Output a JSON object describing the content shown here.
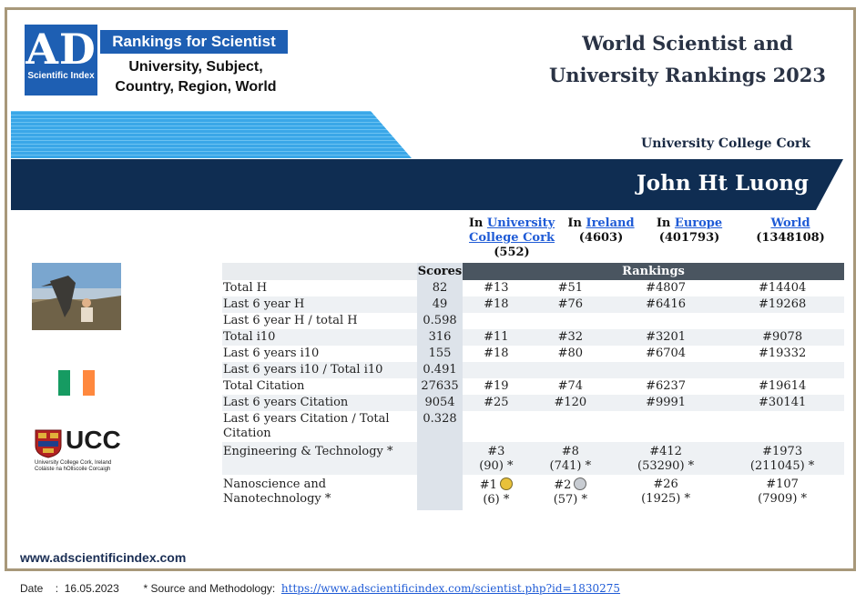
{
  "logo": {
    "mark": "AD",
    "sub": "Scientific Index",
    "title": "Rankings for Scientist",
    "desc": "University, Subject, Country, Region, World"
  },
  "header": {
    "title_line1": "World Scientist and",
    "title_line2": "University Rankings 2023"
  },
  "profile": {
    "university": "University College Cork",
    "name": "John Ht Luong"
  },
  "columns": [
    {
      "prefix": "In",
      "link": "University College Cork",
      "count": "(552)"
    },
    {
      "prefix": "In",
      "link": "Ireland",
      "count": "(4603)"
    },
    {
      "prefix": "In",
      "link": "Europe",
      "count": "(401793)"
    },
    {
      "prefix": "",
      "link": "World",
      "count": "(1348108)"
    }
  ],
  "table": {
    "scores_header": "Scores",
    "rankings_header": "Rankings",
    "rows": [
      {
        "label": "Total H",
        "score": "82",
        "r1": "#13",
        "r2": "#51",
        "r3": "#4807",
        "r4": "#14404"
      },
      {
        "label": "Last 6 year H",
        "score": "49",
        "r1": "#18",
        "r2": "#76",
        "r3": "#6416",
        "r4": "#19268"
      },
      {
        "label": "Last 6 year H / total H",
        "score": "0.598",
        "r1": "",
        "r2": "",
        "r3": "",
        "r4": ""
      },
      {
        "label": "Total i10",
        "score": "316",
        "r1": "#11",
        "r2": "#32",
        "r3": "#3201",
        "r4": "#9078"
      },
      {
        "label": "Last 6 years i10",
        "score": "155",
        "r1": "#18",
        "r2": "#80",
        "r3": "#6704",
        "r4": "#19332"
      },
      {
        "label": "Last 6 years i10 / Total i10",
        "score": "0.491",
        "r1": "",
        "r2": "",
        "r3": "",
        "r4": ""
      },
      {
        "label": "Total Citation",
        "score": "27635",
        "r1": "#19",
        "r2": "#74",
        "r3": "#6237",
        "r4": "#19614"
      },
      {
        "label": "Last 6 years Citation",
        "score": "9054",
        "r1": "#25",
        "r2": "#120",
        "r3": "#9991",
        "r4": "#30141"
      },
      {
        "label": "Last 6 years Citation / Total Citation",
        "score": "0.328",
        "r1": "",
        "r2": "",
        "r3": "",
        "r4": ""
      }
    ],
    "subjects": [
      {
        "label": "Engineering & Technology *",
        "r1": "#3",
        "r1b": "(90) *",
        "r2": "#8",
        "r2b": "(741) *",
        "r3": "#412",
        "r3b": "(53290) *",
        "r4": "#1973",
        "r4b": "(211045) *"
      },
      {
        "label": "Nanoscience and Nanotechnology *",
        "r1": "#1",
        "r1b": "(6) *",
        "r2": "#2",
        "r2b": "(57) *",
        "r3": "#26",
        "r3b": "(1925) *",
        "r4": "#107",
        "r4b": "(7909) *"
      }
    ]
  },
  "site": "www.adscientificindex.com",
  "footer": {
    "date_label": "Date",
    "date_sep": ":",
    "date": "16.05.2023",
    "source_label": "* Source and Methodology:",
    "source_link": "https://www.adscientificindex.com/scientist.php?id=1830275"
  },
  "colors": {
    "brand_blue": "#1e5fb3",
    "navy": "#0f2d52",
    "stripe": "#35a4e6",
    "gold_medal": "#e8c13a",
    "silver_medal": "#c8ccd2"
  }
}
